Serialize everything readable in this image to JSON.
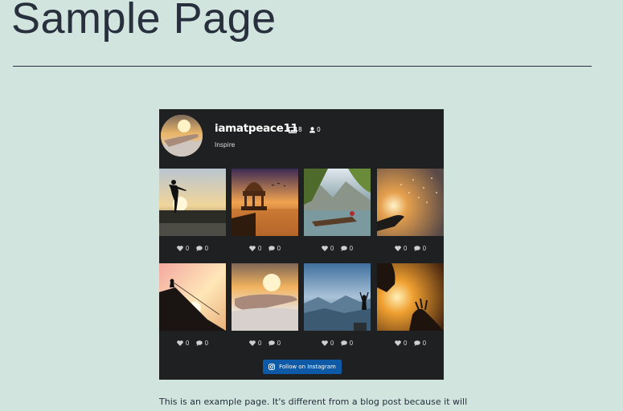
{
  "page": {
    "title": "Sample Page",
    "body_text": "This is an example page. It's different from a blog post because it will"
  },
  "feed": {
    "username": "iamatpeace11",
    "posts_count": "8",
    "followers_count": "0",
    "bio": "Inspire",
    "follow_label": "Follow on Instagram",
    "posts": [
      {
        "likes": "0",
        "comments": "0"
      },
      {
        "likes": "0",
        "comments": "0"
      },
      {
        "likes": "0",
        "comments": "0"
      },
      {
        "likes": "0",
        "comments": "0"
      },
      {
        "likes": "0",
        "comments": "0"
      },
      {
        "likes": "0",
        "comments": "0"
      },
      {
        "likes": "0",
        "comments": "0"
      },
      {
        "likes": "0",
        "comments": "0"
      }
    ]
  },
  "colors": {
    "page_background": "#d1e4dd",
    "text": "#28303d",
    "feed_background": "#1f2021",
    "button": "#0e5aa6"
  }
}
